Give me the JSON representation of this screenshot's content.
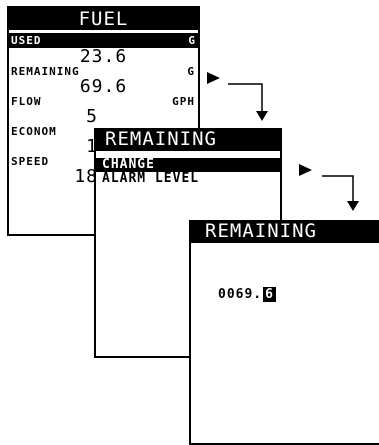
{
  "fuel_screen": {
    "title": "FUEL",
    "used": {
      "label": "USED",
      "unit": "G",
      "value": "23.6"
    },
    "remaining": {
      "label": "REMAINING",
      "unit": "G",
      "value": "69.6"
    },
    "flow": {
      "label": "FLOW",
      "unit": "GPH",
      "value": "5"
    },
    "economy": {
      "label": "ECONOM",
      "value": "1"
    },
    "speed": {
      "label": "SPEED",
      "value": "18"
    }
  },
  "menu_screen": {
    "title": "REMAINING",
    "items": [
      {
        "label": "CHANGE",
        "selected": true
      },
      {
        "label": "ALARM LEVEL",
        "selected": false
      }
    ]
  },
  "edit_screen": {
    "title": "REMAINING",
    "value_fixed": "0069.",
    "value_cursor": "6"
  }
}
